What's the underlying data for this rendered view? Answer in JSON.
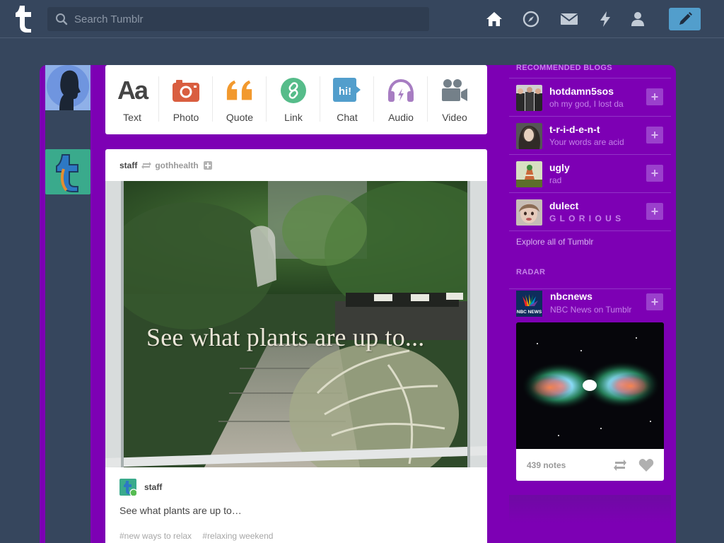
{
  "header": {
    "search_placeholder": "Search Tumblr",
    "nav": [
      "home-icon",
      "explore-compass-icon",
      "inbox-envelope-icon",
      "activity-lightning-icon",
      "account-person-icon",
      "compose-pencil-icon"
    ]
  },
  "post_types": [
    {
      "label": "Text",
      "glyph": "Aa",
      "color": "#444444"
    },
    {
      "label": "Photo",
      "color": "#d95e40"
    },
    {
      "label": "Quote",
      "color": "#f2992e"
    },
    {
      "label": "Link",
      "color": "#56bc8a"
    },
    {
      "label": "Chat",
      "glyph": "hi!",
      "color": "#529ecc"
    },
    {
      "label": "Audio",
      "color": "#a77dc2"
    },
    {
      "label": "Video",
      "color": "#748089"
    }
  ],
  "post": {
    "author": "staff",
    "reblogged_from": "gothhealth",
    "image_text": "See what plants are up to...",
    "reblogger": "staff",
    "body": "See what plants are up to…",
    "tags": [
      "#new ways to relax",
      "#relaxing weekend"
    ]
  },
  "sidebar": {
    "recommended_heading": "RECOMMENDED BLOGS",
    "recommended": [
      {
        "name": "hotdamn5sos",
        "tagline": "oh my god, I lost da"
      },
      {
        "name": "t-r-i-d-e-n-t",
        "tagline": "Your words are acid"
      },
      {
        "name": "ugly",
        "tagline": "rad"
      },
      {
        "name": "dulect",
        "tagline": "G L O R I O U S"
      }
    ],
    "follow_label": "+",
    "explore_link": "Explore all of Tumblr",
    "radar_heading": "RADAR",
    "radar": {
      "name": "nbcnews",
      "tagline": "NBC News on Tumblr",
      "avatar_text": "NBC NEWS",
      "notes": "439 notes"
    }
  },
  "colors": {
    "background": "#36465d",
    "dashboard_frame": "#7d00b4",
    "accent_blue": "#529ecc"
  }
}
